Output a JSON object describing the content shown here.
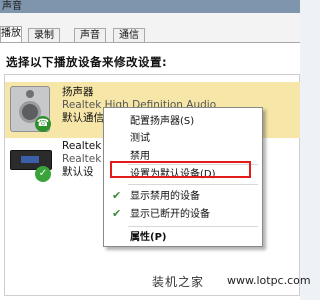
{
  "window": {
    "title": "声音"
  },
  "tabs": [
    {
      "label": "播放"
    },
    {
      "label": "录制"
    },
    {
      "label": "声音"
    },
    {
      "label": "通信"
    }
  ],
  "prompt": "选择以下播放设备来修改设置:",
  "devices": [
    {
      "name": "扬声器",
      "desc": "Realtek High Definition Audio",
      "status": "默认通信设备"
    },
    {
      "name": "Realtek",
      "desc": "Realtek",
      "status": "默认设"
    }
  ],
  "context_menu": {
    "items": [
      {
        "label": "配置扬声器(S)"
      },
      {
        "label": "测试"
      },
      {
        "label": "禁用"
      },
      {
        "label": "设置为默认设备(D)"
      },
      {
        "label": "显示禁用的设备",
        "checked": true
      },
      {
        "label": "显示已断开的设备",
        "checked": true
      },
      {
        "label": "属性(P)"
      }
    ]
  },
  "watermark": {
    "brand": "装机之家",
    "url": "www.lotpc.com"
  },
  "colors": {
    "selection": "#f6e7a8",
    "highlight_box": "#e31b1b",
    "check": "#3aa43a"
  }
}
